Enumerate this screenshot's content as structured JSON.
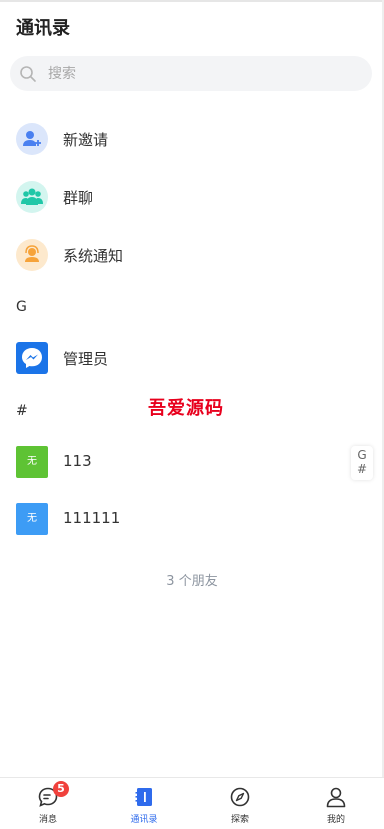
{
  "header": {
    "title": "通讯录"
  },
  "search": {
    "placeholder": "搜索"
  },
  "functions": [
    {
      "label": "新邀请",
      "icon": "add-user-icon",
      "bg": "#dbe6fb",
      "fg": "#4a80f0"
    },
    {
      "label": "群聊",
      "icon": "group-icon",
      "bg": "#d3f5ef",
      "fg": "#1fc7a7"
    },
    {
      "label": "系统通知",
      "icon": "notification-icon",
      "bg": "#fde9cd",
      "fg": "#f6a33a"
    }
  ],
  "sections": [
    {
      "letter": "G",
      "contacts": [
        {
          "name": "管理员",
          "avatar_icon": "messenger-icon",
          "color": "#1b74e8"
        }
      ]
    },
    {
      "letter": "#",
      "contacts": [
        {
          "name": "113",
          "avatar_text": "无",
          "color": "#5ec334"
        },
        {
          "name": "111111",
          "avatar_text": "无",
          "color": "#3d9cf5"
        }
      ]
    }
  ],
  "watermark": "吾爱源码",
  "index_bar": [
    "G",
    "#"
  ],
  "footer": {
    "friend_count": "3 个朋友"
  },
  "tabbar": [
    {
      "label": "消息",
      "icon": "chat-icon",
      "badge": "5",
      "active": false
    },
    {
      "label": "通讯录",
      "icon": "contacts-book-icon",
      "active": true
    },
    {
      "label": "探索",
      "icon": "compass-icon",
      "active": false
    },
    {
      "label": "我的",
      "icon": "profile-icon",
      "active": false
    }
  ],
  "colors": {
    "accent": "#2f6bec",
    "badge": "#f0413c",
    "watermark": "#e8001d"
  }
}
